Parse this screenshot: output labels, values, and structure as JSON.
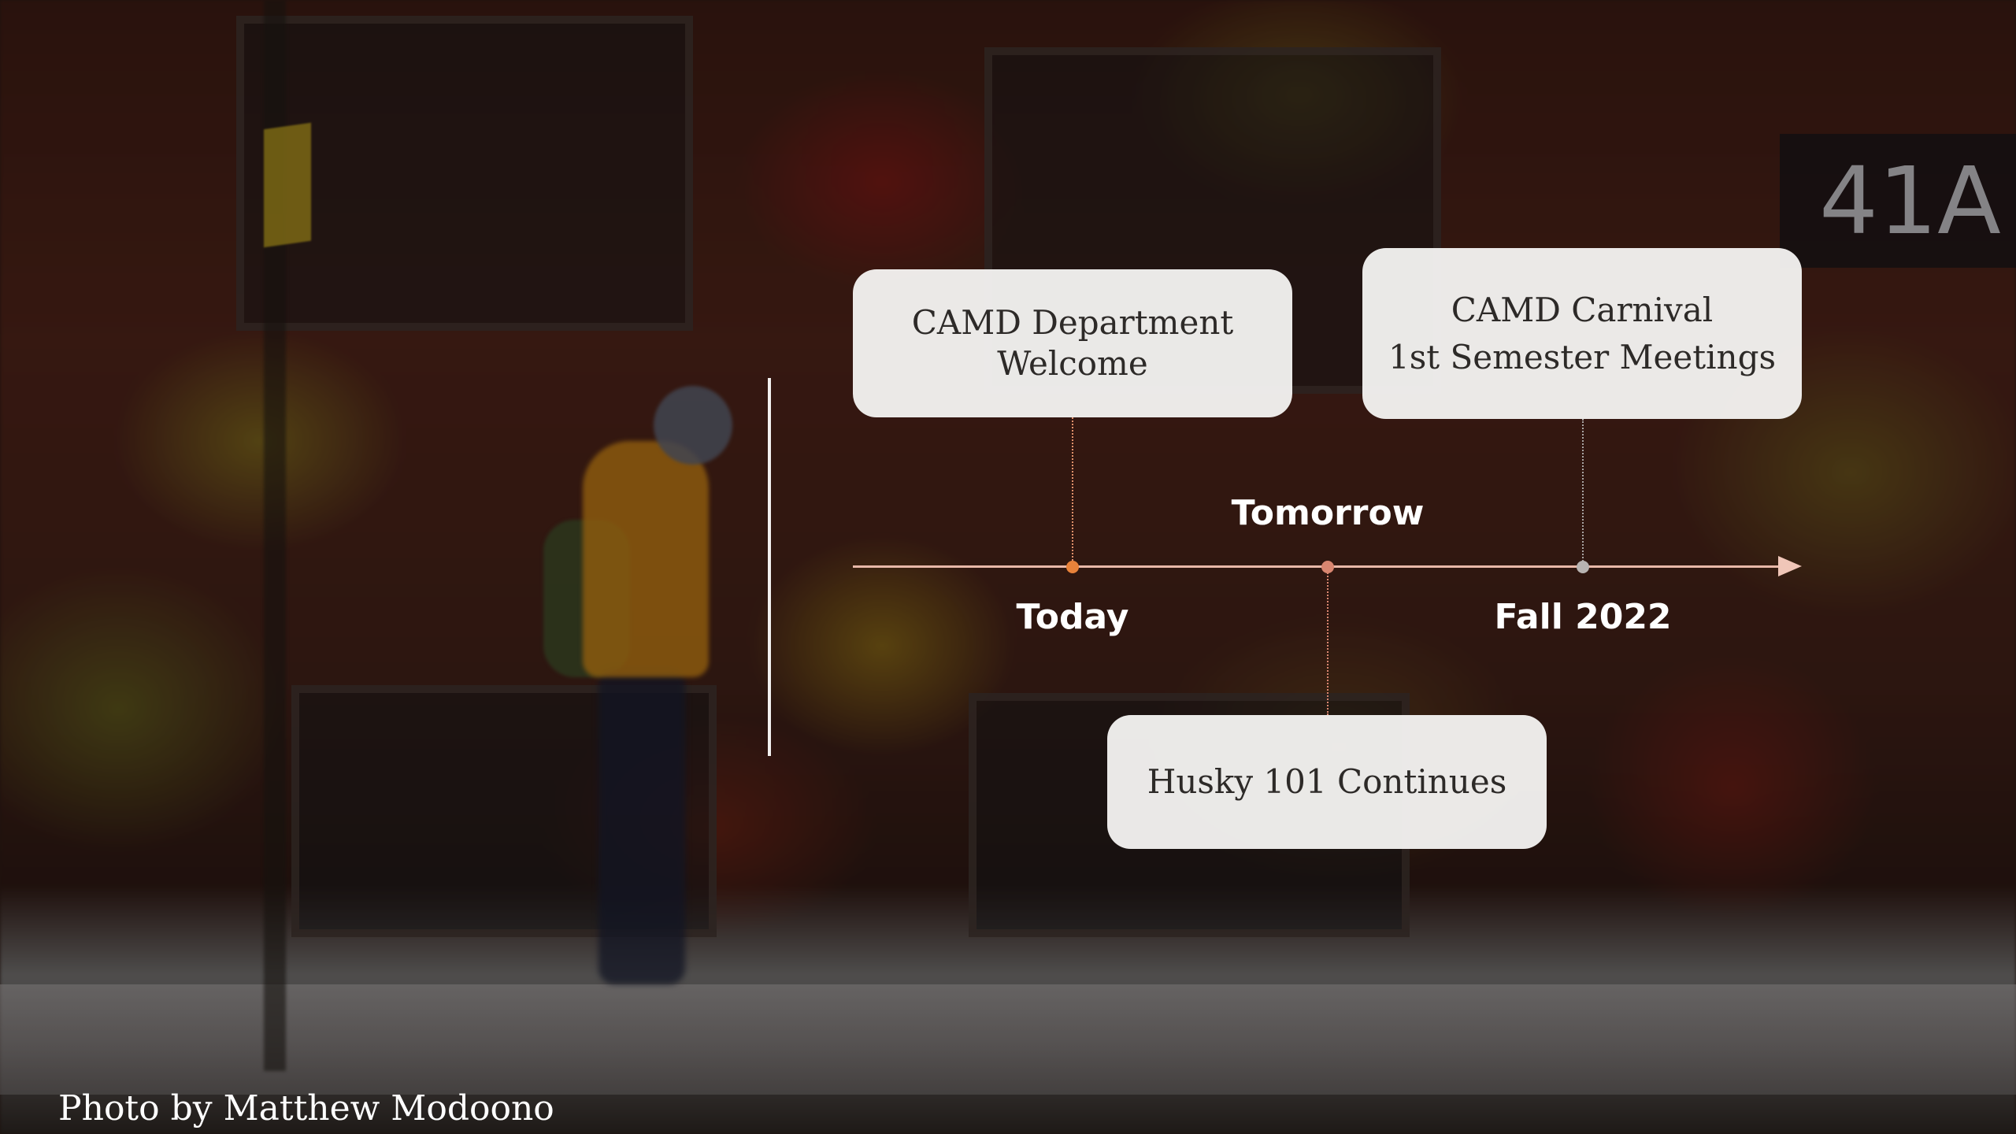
{
  "colors": {
    "card_background": "#f6f4f3",
    "card_text": "#2d2a28",
    "axis_line": "#e8b8a8",
    "dot_today": "#e8823a",
    "dot_tomorrow": "#d98670",
    "dot_fall": "#b8b4b2",
    "label_text": "#ffffff"
  },
  "building_number": "41A",
  "timeline": {
    "milestones": [
      {
        "label": "Today",
        "card_lines": [
          "CAMD Department",
          "Welcome"
        ]
      },
      {
        "label": "Tomorrow",
        "card_lines": [
          "Husky 101 Continues"
        ]
      },
      {
        "label": "Fall 2022",
        "card_lines": [
          "CAMD Carnival",
          "1st Semester Meetings"
        ]
      }
    ]
  },
  "photo_credit": "Photo by Matthew Modoono"
}
